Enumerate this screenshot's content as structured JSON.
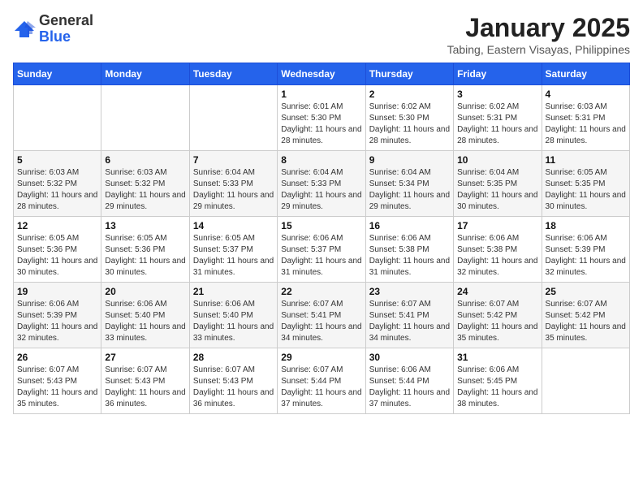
{
  "header": {
    "logo_general": "General",
    "logo_blue": "Blue",
    "month_year": "January 2025",
    "location": "Tabing, Eastern Visayas, Philippines"
  },
  "weekdays": [
    "Sunday",
    "Monday",
    "Tuesday",
    "Wednesday",
    "Thursday",
    "Friday",
    "Saturday"
  ],
  "weeks": [
    [
      {
        "day": "",
        "info": ""
      },
      {
        "day": "",
        "info": ""
      },
      {
        "day": "",
        "info": ""
      },
      {
        "day": "1",
        "info": "Sunrise: 6:01 AM\nSunset: 5:30 PM\nDaylight: 11 hours and 28 minutes."
      },
      {
        "day": "2",
        "info": "Sunrise: 6:02 AM\nSunset: 5:30 PM\nDaylight: 11 hours and 28 minutes."
      },
      {
        "day": "3",
        "info": "Sunrise: 6:02 AM\nSunset: 5:31 PM\nDaylight: 11 hours and 28 minutes."
      },
      {
        "day": "4",
        "info": "Sunrise: 6:03 AM\nSunset: 5:31 PM\nDaylight: 11 hours and 28 minutes."
      }
    ],
    [
      {
        "day": "5",
        "info": "Sunrise: 6:03 AM\nSunset: 5:32 PM\nDaylight: 11 hours and 28 minutes."
      },
      {
        "day": "6",
        "info": "Sunrise: 6:03 AM\nSunset: 5:32 PM\nDaylight: 11 hours and 29 minutes."
      },
      {
        "day": "7",
        "info": "Sunrise: 6:04 AM\nSunset: 5:33 PM\nDaylight: 11 hours and 29 minutes."
      },
      {
        "day": "8",
        "info": "Sunrise: 6:04 AM\nSunset: 5:33 PM\nDaylight: 11 hours and 29 minutes."
      },
      {
        "day": "9",
        "info": "Sunrise: 6:04 AM\nSunset: 5:34 PM\nDaylight: 11 hours and 29 minutes."
      },
      {
        "day": "10",
        "info": "Sunrise: 6:04 AM\nSunset: 5:35 PM\nDaylight: 11 hours and 30 minutes."
      },
      {
        "day": "11",
        "info": "Sunrise: 6:05 AM\nSunset: 5:35 PM\nDaylight: 11 hours and 30 minutes."
      }
    ],
    [
      {
        "day": "12",
        "info": "Sunrise: 6:05 AM\nSunset: 5:36 PM\nDaylight: 11 hours and 30 minutes."
      },
      {
        "day": "13",
        "info": "Sunrise: 6:05 AM\nSunset: 5:36 PM\nDaylight: 11 hours and 30 minutes."
      },
      {
        "day": "14",
        "info": "Sunrise: 6:05 AM\nSunset: 5:37 PM\nDaylight: 11 hours and 31 minutes."
      },
      {
        "day": "15",
        "info": "Sunrise: 6:06 AM\nSunset: 5:37 PM\nDaylight: 11 hours and 31 minutes."
      },
      {
        "day": "16",
        "info": "Sunrise: 6:06 AM\nSunset: 5:38 PM\nDaylight: 11 hours and 31 minutes."
      },
      {
        "day": "17",
        "info": "Sunrise: 6:06 AM\nSunset: 5:38 PM\nDaylight: 11 hours and 32 minutes."
      },
      {
        "day": "18",
        "info": "Sunrise: 6:06 AM\nSunset: 5:39 PM\nDaylight: 11 hours and 32 minutes."
      }
    ],
    [
      {
        "day": "19",
        "info": "Sunrise: 6:06 AM\nSunset: 5:39 PM\nDaylight: 11 hours and 32 minutes."
      },
      {
        "day": "20",
        "info": "Sunrise: 6:06 AM\nSunset: 5:40 PM\nDaylight: 11 hours and 33 minutes."
      },
      {
        "day": "21",
        "info": "Sunrise: 6:06 AM\nSunset: 5:40 PM\nDaylight: 11 hours and 33 minutes."
      },
      {
        "day": "22",
        "info": "Sunrise: 6:07 AM\nSunset: 5:41 PM\nDaylight: 11 hours and 34 minutes."
      },
      {
        "day": "23",
        "info": "Sunrise: 6:07 AM\nSunset: 5:41 PM\nDaylight: 11 hours and 34 minutes."
      },
      {
        "day": "24",
        "info": "Sunrise: 6:07 AM\nSunset: 5:42 PM\nDaylight: 11 hours and 35 minutes."
      },
      {
        "day": "25",
        "info": "Sunrise: 6:07 AM\nSunset: 5:42 PM\nDaylight: 11 hours and 35 minutes."
      }
    ],
    [
      {
        "day": "26",
        "info": "Sunrise: 6:07 AM\nSunset: 5:43 PM\nDaylight: 11 hours and 35 minutes."
      },
      {
        "day": "27",
        "info": "Sunrise: 6:07 AM\nSunset: 5:43 PM\nDaylight: 11 hours and 36 minutes."
      },
      {
        "day": "28",
        "info": "Sunrise: 6:07 AM\nSunset: 5:43 PM\nDaylight: 11 hours and 36 minutes."
      },
      {
        "day": "29",
        "info": "Sunrise: 6:07 AM\nSunset: 5:44 PM\nDaylight: 11 hours and 37 minutes."
      },
      {
        "day": "30",
        "info": "Sunrise: 6:06 AM\nSunset: 5:44 PM\nDaylight: 11 hours and 37 minutes."
      },
      {
        "day": "31",
        "info": "Sunrise: 6:06 AM\nSunset: 5:45 PM\nDaylight: 11 hours and 38 minutes."
      },
      {
        "day": "",
        "info": ""
      }
    ]
  ]
}
